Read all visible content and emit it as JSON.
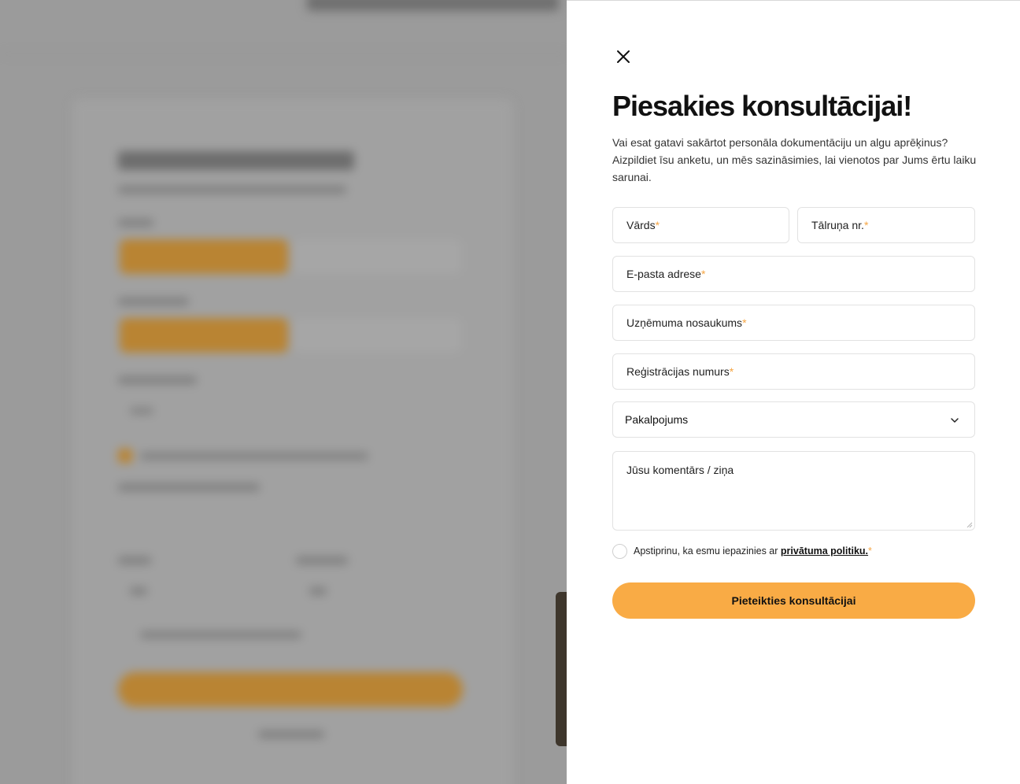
{
  "panel": {
    "title": "Piesakies konsultācijai!",
    "intro": "Vai esat gatavi sakārtot personāla dokumentāciju un algu aprēķinus? Aizpildiet īsu anketu, un mēs sazināsimies, lai vienotos par Jums ērtu laiku sarunai.",
    "close_icon": "close-icon",
    "fields": {
      "name": {
        "label": "Vārds",
        "required_mark": "*"
      },
      "phone": {
        "label": "Tālruņa nr.",
        "required_mark": "*"
      },
      "email": {
        "label": "E-pasta adrese",
        "required_mark": "*"
      },
      "company": {
        "label": "Uzņēmuma nosaukums",
        "required_mark": "*"
      },
      "reg_number": {
        "label": "Reģistrācijas numurs",
        "required_mark": "*"
      },
      "service": {
        "label": "Pakalpojums",
        "icon": "chevron-down-icon"
      },
      "comment": {
        "label": "Jūsu komentārs / ziņa"
      }
    },
    "consent": {
      "text": "Apstiprinu, ka esmu iepazinies ar ",
      "link": "privātuma politiku.",
      "required_mark": "*"
    },
    "submit_label": "Pieteikties konsultācijai"
  },
  "colors": {
    "accent": "#f9ab45",
    "required": "#f5a442",
    "overlay": "#9b9b9b"
  }
}
